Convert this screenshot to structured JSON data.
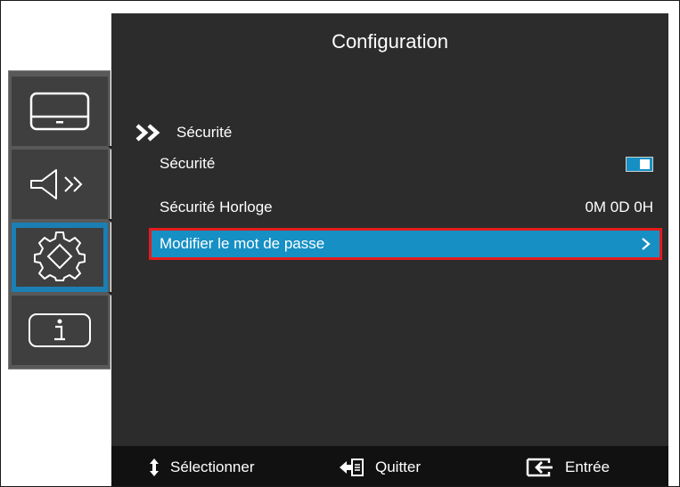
{
  "title": "Configuration",
  "sidebar": {
    "tabs": [
      {
        "icon": "display-icon",
        "active": false
      },
      {
        "icon": "audio-icon",
        "active": false
      },
      {
        "icon": "gear-icon",
        "active": true
      },
      {
        "icon": "info-icon",
        "active": false
      }
    ]
  },
  "section": {
    "label": "Sécurité"
  },
  "menu": {
    "items": [
      {
        "label": "Sécurité",
        "control": "toggle",
        "state": "on"
      },
      {
        "label": "Sécurité Horloge",
        "value": "0M 0D 0H"
      },
      {
        "label": "Modifier le mot de passe",
        "control": "chevron-right",
        "selected": true
      }
    ]
  },
  "footer": {
    "select": "Sélectionner",
    "exit": "Quitter",
    "enter": "Entrée"
  },
  "colors": {
    "panel": "#2c2c2c",
    "accent": "#1690c4",
    "highlight_border": "#e51b1b",
    "footer": "#111111"
  }
}
